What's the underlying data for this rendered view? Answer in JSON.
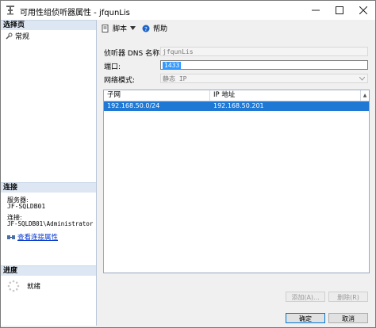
{
  "window": {
    "title": "可用性组侦听器属性 - jfqunLis"
  },
  "left_panel": {
    "select_page_heading": "选择页",
    "pages": [
      {
        "label": "常规"
      }
    ],
    "connection_heading": "连接",
    "server_label": "服务器:",
    "server_value": "JF-SQLDB01",
    "connection_label": "连接:",
    "connection_value": "JF-SQLDB01\\Administrator",
    "view_properties_link": "查看连接属性",
    "progress_heading": "进度",
    "progress_status": "就绪"
  },
  "toolbar": {
    "script_label": "脚本",
    "help_label": "帮助"
  },
  "form": {
    "dns_label": "侦听器 DNS 名称:",
    "dns_value": "jfqunLis",
    "port_label": "端口:",
    "port_value": "1433",
    "network_mode_label": "网络模式:",
    "network_mode_value": "静态 IP"
  },
  "grid": {
    "columns": [
      "子网",
      "IP 地址"
    ],
    "rows": [
      {
        "subnet": "192.168.50.0/24",
        "ip": "192.168.50.201"
      }
    ]
  },
  "buttons": {
    "add": "添加(A)...",
    "remove": "删除(R)",
    "ok": "确定",
    "cancel": "取消"
  },
  "colors": {
    "selection": "#1e78d4",
    "link": "#0033cc",
    "section_header": "#dde7f3"
  }
}
